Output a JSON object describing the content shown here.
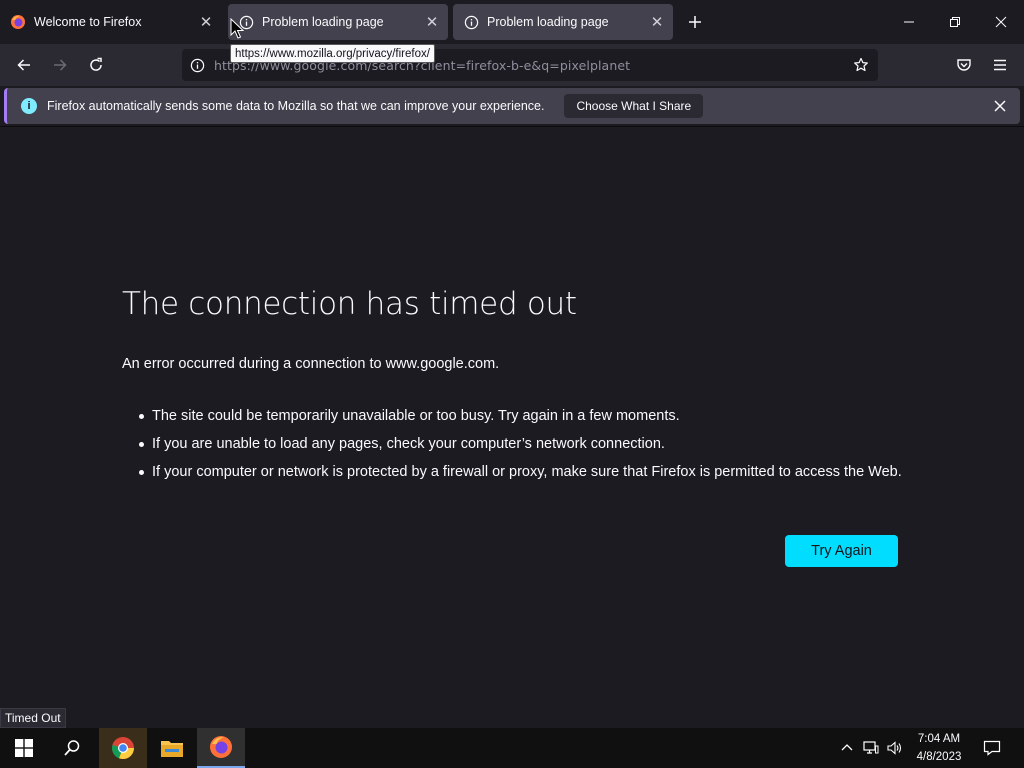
{
  "tabs": [
    {
      "label": "Welcome to Firefox",
      "icon": "firefox-icon"
    },
    {
      "label": "Problem loading page",
      "icon": "info-icon"
    },
    {
      "label": "Problem loading page",
      "icon": "info-icon"
    }
  ],
  "tooltip": "https://www.mozilla.org/privacy/firefox/",
  "navbar": {
    "url": "https://www.google.com/search?client=firefox-b-e&q=pixelplanet"
  },
  "notification": {
    "text": "Firefox automatically sends some data to Mozilla so that we can improve your experience.",
    "button": "Choose What I Share"
  },
  "error": {
    "title": "The connection has timed out",
    "description": "An error occurred during a connection to www.google.com.",
    "bullets": [
      "The site could be temporarily unavailable or too busy. Try again in a few moments.",
      "If you are unable to load any pages, check your computer’s network connection.",
      "If your computer or network is protected by a firewall or proxy, make sure that Firefox is permitted to access the Web."
    ],
    "button": "Try Again"
  },
  "status": "Timed Out",
  "clock": {
    "time": "7:04 AM",
    "date": "4/8/2023"
  },
  "colors": {
    "accent": "#00ddff",
    "background": "#1c1b22",
    "toolbar": "#2b2a33"
  }
}
